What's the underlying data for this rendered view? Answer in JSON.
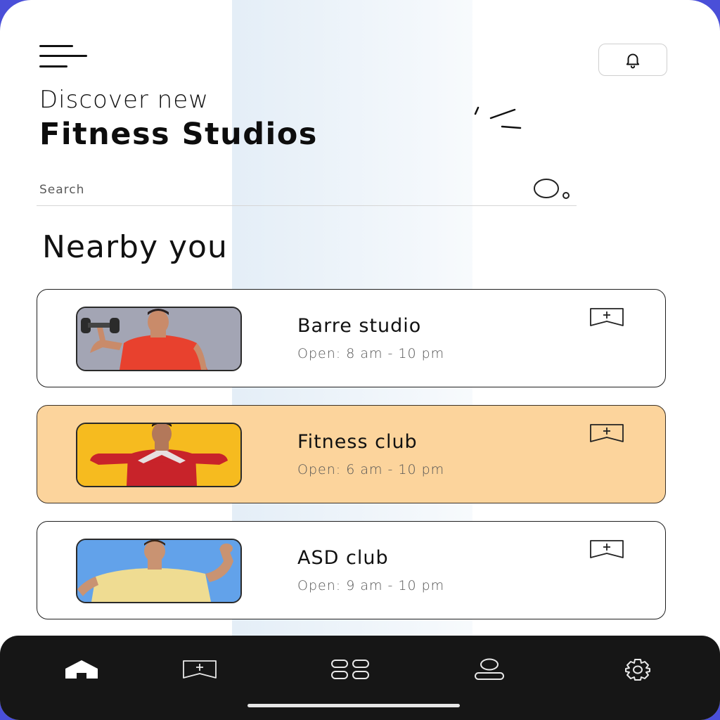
{
  "header": {
    "subtitle": "Discover new",
    "title": "Fitness Studios",
    "menu_icon": "menu-icon",
    "notification_icon": "bell-icon"
  },
  "search": {
    "placeholder": "Search",
    "value": "",
    "icon": "search-icon"
  },
  "section": {
    "title": "Nearby you"
  },
  "studios": [
    {
      "name": "Barre studio",
      "hours": "Open: 8 am - 10 pm",
      "highlighted": false,
      "photo": "man-red-shirt-dumbbell",
      "photo_bg": "#9a9cab",
      "bookmark_icon": "bookmark-add-icon"
    },
    {
      "name": "Fitness club",
      "hours": "Open: 6 am - 10 pm",
      "highlighted": true,
      "photo": "man-red-jacket-heart-hands",
      "photo_bg": "#f5b921",
      "bookmark_icon": "bookmark-add-icon"
    },
    {
      "name": "ASD club",
      "hours": "Open: 9 am - 10 pm",
      "highlighted": false,
      "photo": "man-yellow-shirt-flexing",
      "photo_bg": "#5f9fe6",
      "bookmark_icon": "bookmark-add-icon"
    }
  ],
  "bottom_nav": {
    "items": [
      {
        "icon": "home-icon",
        "active": true
      },
      {
        "icon": "bookmark-add-icon",
        "active": false
      },
      {
        "icon": "grid-icon",
        "active": false
      },
      {
        "icon": "user-icon",
        "active": false
      },
      {
        "icon": "gear-icon",
        "active": false
      }
    ]
  },
  "colors": {
    "highlight_card": "#fcd49c",
    "nav_background": "#161616",
    "frame": "#4a4fd8"
  }
}
